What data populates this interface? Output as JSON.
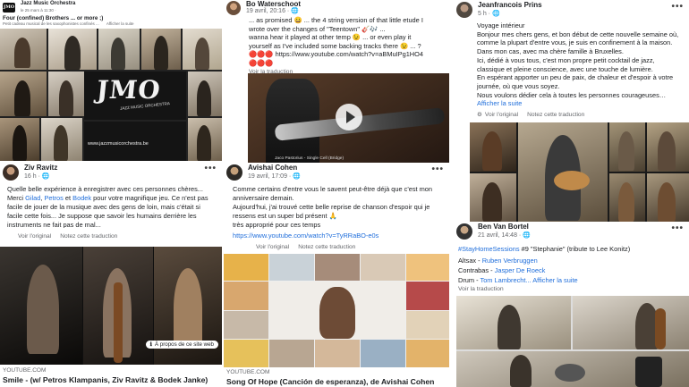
{
  "post1": {
    "logo_text": "JMO",
    "page_name": "Jazz Music Orchestra",
    "date": "le 25 mars à 11:30 · ",
    "title": "Four (confined) Brothers ... or more ;)",
    "subtitle": "Petit cadeau musical de les saxophonistes confinés ...",
    "translate": "Afficher la suite",
    "jmo_logo": "JMO",
    "jmo_sub": "JAZZ MUSIC ORCHESTRA",
    "website": "www.jazzmusicorchestra.be"
  },
  "post2": {
    "author": "Ziv Ravitz",
    "time": "16 h · ",
    "text_a": "Quelle belle expérience à enregistrer avec ces personnes chères... Merci ",
    "tag1": "Gilad",
    "sep1": ", ",
    "tag2": "Petros",
    "sep2": " et ",
    "tag3": "Bodek",
    "text_b": " pour votre magnifique jeu. Ce n'est pas facile de jouer de la musique avec des gens de loin, mais c'était si facile cette fois... Je suppose que savoir les humains derrière les instruments ne fait pas de mal...",
    "see_original": "Voir l'original",
    "rate": "Notez cette traduction",
    "source": "YOUTUBE.COM",
    "video_title": "Smile - (w/ Petros Klampanis, Ziv Ravitz & Bodek Janke)",
    "about": "À propos de ce site web"
  },
  "post3": {
    "author": "Bo Waterschoot",
    "time": "19 avril, 20:16 · ",
    "line1": "... as promised 😀 ... the 4 string version of that little etude I wrote over the changes of \"Teentown\" 🎸🎶 ...",
    "line2": "wanna hear it played at other temp 😉 ... or even play it yourself as I've included some backing tracks there 😉 ... ?",
    "emoji_row": "🔴🔴🔴 https://www.youtube.com/watch?v=aBMuIPg1HO4",
    "emoji_row2": "🔴🔴🔴",
    "translate": "Voir la traduction",
    "video_caption": "Jaco Pastorius - Single Cell (Bridge)"
  },
  "post4": {
    "author": "Avishai Cohen",
    "time": "19 avril, 17:09 · ",
    "line1": "Comme certains d'entre vous le savent peut-être déjà que c'est mon anniversaire demain.",
    "line2": "Aujourd'hui, j'ai trouvé cette belle reprise de chanson d'espoir qui je ressens est un super bd présent 🙏",
    "line3": "très approprié pour ces temps",
    "url": "https://www.youtube.com/watch?v=TyRRaBO-e0s",
    "see_original": "Voir l'original",
    "rate": "Notez cette traduction",
    "source": "YOUTUBE.COM",
    "video_title": "Song Of Hope (Canción de esperanza), de Avishai Cohen"
  },
  "post5": {
    "author": "Jeanfrancois Prins",
    "time": "5 h · ",
    "heading": "Voyage intérieur",
    "p1": "Bonjour mes chers gens, et bon début de cette nouvelle semaine où, comme la plupart d'entre vous, je suis en confinement à la maison. Dans mon cas, avec ma chère famille à Bruxelles.",
    "p2": "Ici, dédié à vous tous, c'est mon propre petit cocktail de jazz, classique et pleine conscience, avec une touche de lumière.",
    "p3": "En espérant apporter un peu de paix, de chaleur et d'espoir à votre journée, où que vous soyez.",
    "p4": "Nous voulons dédier cela à toutes les personnes courageuses…",
    "more": "Afficher la suite",
    "see_original": "Voir l'original",
    "rate": "Notez cette traduction"
  },
  "post6": {
    "author": "Ben Van Bortel",
    "time": "21 avril, 14:48 · ",
    "hashtag": "#StayHomeSessions",
    "hashtag_rest": " #9 \"Stephanie\" (tribute to Lee Konitz)",
    "r1_label": "Altsax - ",
    "r1_name": "Ruben Verbruggen",
    "r2_label": "Contrabas - ",
    "r2_name": "Jasper De Roeck",
    "r3_label": "Drum - ",
    "r3_name": "Tom Lambrecht...",
    "more": " Afficher la suite",
    "translate": "Voir la traduction"
  },
  "colors": {
    "link": "#216fdb",
    "muted": "#65676b",
    "bg_dark": "#1b1b1b"
  }
}
